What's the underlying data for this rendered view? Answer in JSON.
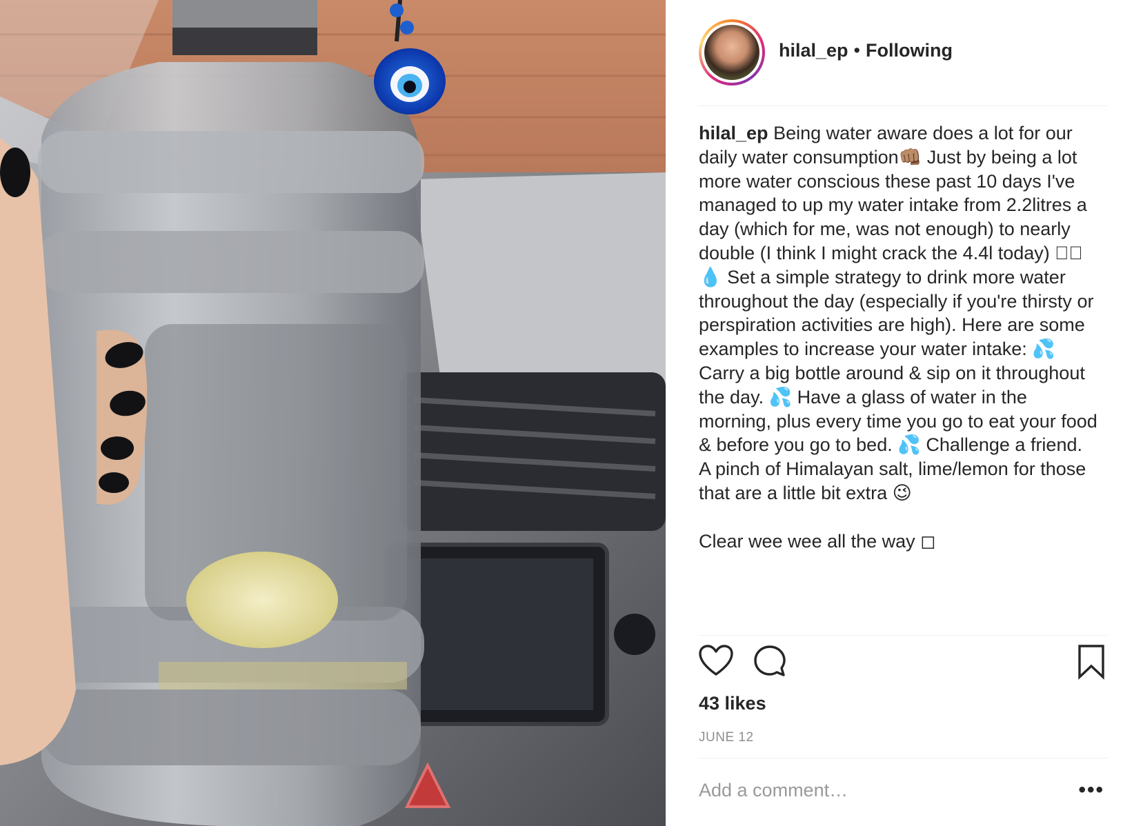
{
  "post": {
    "username": "hilal_ep",
    "separator": "•",
    "follow_status": "Following",
    "caption_user": "hilal_ep",
    "caption_text": "Being water aware does a lot for our daily water consumption👊🏽  Just by being a lot more water conscious these past 10 days I've managed to up my water intake from 2.2litres a day (which for me, was not enough) to nearly double (I think I might crack the 4.4l today) ◻🏽  💧 Set a simple strategy to drink more water throughout the day (especially if you're thirsty or perspiration activities are high). Here are some examples to increase your water intake: 💦 Carry a big bottle around & sip on it throughout the day. 💦 Have a glass of water in the morning, plus every time you go to eat your food & before you go to bed. 💦  Challenge a friend.\nA pinch of Himalayan salt, lime/lemon for those that are a little bit extra 😉\n\nClear wee wee all the way ◻",
    "likes": "43 likes",
    "date": "JUNE 12",
    "comment_placeholder": "Add a comment…",
    "more_label": "•••"
  },
  "icons": {
    "like": "heart-icon",
    "comment": "comment-bubble-icon",
    "save": "bookmark-icon",
    "more": "more-options-icon"
  },
  "colors": {
    "text": "#262626",
    "muted": "#8e8e8e",
    "divider": "#efefef"
  }
}
